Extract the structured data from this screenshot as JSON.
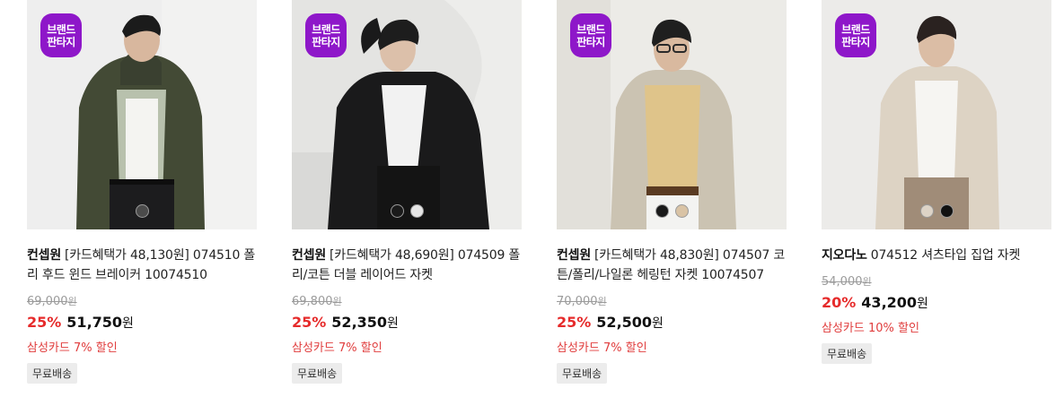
{
  "products": [
    {
      "badge_line1": "브랜드",
      "badge_line2": "판타지",
      "brand": "컨셉원",
      "title": "[카드혜택가 48,130원] 074510 폴리 후드 윈드 브레이커 10074510",
      "original_price": "69,000",
      "original_unit": "원",
      "discount": "25%",
      "price": "51,750",
      "price_unit": "원",
      "card_benefit": "삼성카드 7% 할인",
      "shipping": "무료배송",
      "swatch_colors": [
        "#4b4b4b"
      ]
    },
    {
      "badge_line1": "브랜드",
      "badge_line2": "판타지",
      "brand": "컨셉원",
      "title": "[카드혜택가 48,690원] 074509 폴리/코튼 더블 레이어드 자켓",
      "original_price": "69,800",
      "original_unit": "원",
      "discount": "25%",
      "price": "52,350",
      "price_unit": "원",
      "card_benefit": "삼성카드 7% 할인",
      "shipping": "무료배송",
      "swatch_colors": [
        "#1a1a1a",
        "#e6e6e6"
      ]
    },
    {
      "badge_line1": "브랜드",
      "badge_line2": "판타지",
      "brand": "컨셉원",
      "title": "[카드혜택가 48,830원] 074507 코튼/폴리/나일론 헤링턴 자켓 10074507",
      "original_price": "70,000",
      "original_unit": "원",
      "discount": "25%",
      "price": "52,500",
      "price_unit": "원",
      "card_benefit": "삼성카드 7% 할인",
      "shipping": "무료배송",
      "swatch_colors": [
        "#1a1a1a",
        "#d9c3a5"
      ]
    },
    {
      "badge_line1": "브랜드",
      "badge_line2": "판타지",
      "brand": "지오다노",
      "title": "074512 셔츠타입 집업 자켓",
      "original_price": "54,000",
      "original_unit": "원",
      "discount": "20%",
      "price": "43,200",
      "price_unit": "원",
      "card_benefit": "삼성카드 10% 할인",
      "shipping": "무료배송",
      "swatch_colors": [
        "#ddd3c6",
        "#111111"
      ]
    }
  ],
  "colors": {
    "badge": "#8e17c9",
    "discount": "#e62b2b",
    "benefit": "#e03d3d",
    "tag_bg": "#ececec"
  }
}
